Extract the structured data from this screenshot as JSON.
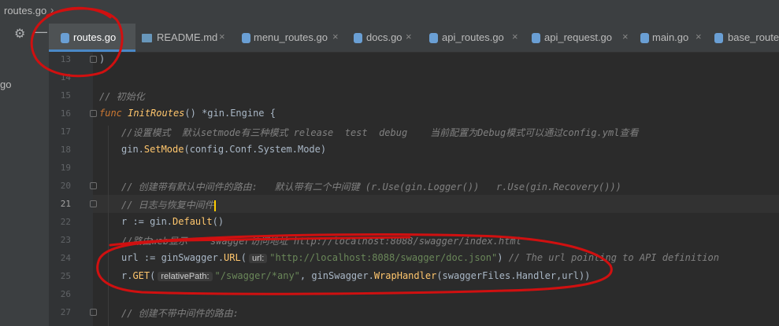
{
  "breadcrumb": {
    "file": "routes.go",
    "chevron": "›"
  },
  "left_panel": {
    "fragment": "go"
  },
  "tabs": [
    {
      "label": "routes.go",
      "icon": "go-file-icon",
      "active": true
    },
    {
      "label": "README.md",
      "icon": "markdown-file-icon",
      "active": false
    },
    {
      "label": "menu_routes.go",
      "icon": "go-file-icon",
      "active": false
    },
    {
      "label": "docs.go",
      "icon": "go-file-icon",
      "active": false
    },
    {
      "label": "api_routes.go",
      "icon": "go-file-icon",
      "active": false
    },
    {
      "label": "api_request.go",
      "icon": "go-file-icon",
      "active": false
    },
    {
      "label": "main.go",
      "icon": "go-file-icon",
      "active": false
    },
    {
      "label": "base_route",
      "icon": "go-file-icon",
      "active": false
    }
  ],
  "tab_close": "×",
  "line_numbers": [
    "13",
    "14",
    "15",
    "16",
    "17",
    "18",
    "19",
    "20",
    "21",
    "22",
    "23",
    "24",
    "25",
    "26",
    "27"
  ],
  "current_line": "21",
  "code": {
    "l13": ")",
    "l15": "// 初始化",
    "l16_func": "func",
    "l16_name": "InitRoutes",
    "l16_rest": "() *gin.Engine {",
    "l17": "//设置模式  默认setmode有三种模式 release  test  debug    当前配置为Debug模式可以通过config.yml查看",
    "l18_pkg": "gin.",
    "l18_fn": "SetMode",
    "l18_rest": "(config.Conf.System.Mode)",
    "l20": "// 创建带有默认中间件的路由:   默认带有二个中间键 (r.Use(gin.Logger())   r.Use(gin.Recovery()))",
    "l21": "// 日志与恢复中间件",
    "l22_a": "r := gin.",
    "l22_fn": "Default",
    "l22_b": "()",
    "l23": "//路由web显示    swagger访问地址 http://localhost:8088/swagger/index.html",
    "l24_a": "url := ginSwagger.",
    "l24_fn": "URL",
    "l24_b": "(",
    "l24_hint": "url:",
    "l24_str": "\"http://localhost:8088/swagger/doc.json\"",
    "l24_c": ")",
    "l24_cm": " // The url pointing to API definition",
    "l25_a": "r.",
    "l25_fn": "GET",
    "l25_b": "(",
    "l25_hint": "relativePath:",
    "l25_str": "\"/swagger/*any\"",
    "l25_c": ", ginSwagger.",
    "l25_fn2": "WrapHandler",
    "l25_d": "(swaggerFiles.",
    "l25_e": "Handler,url))",
    "l27": "// 创建不带中间件的路由:"
  },
  "colors": {
    "editor_bg": "#2b2b2b",
    "keyword": "#cc7832",
    "function": "#ffc66d",
    "string": "#6a8759",
    "comment": "#808080",
    "annotation_ink": "#d01010",
    "active_tab_underline": "#4a88c7"
  }
}
